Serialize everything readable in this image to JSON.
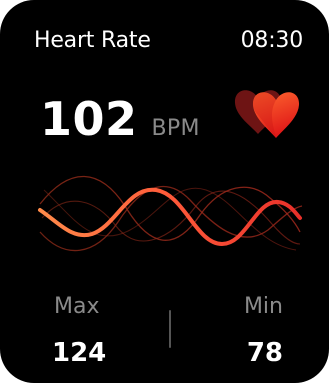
{
  "screen": {
    "title": "Heart Rate",
    "time": "08:30"
  },
  "reading": {
    "value": "102",
    "unit": "BPM"
  },
  "stats": {
    "max_label": "Max",
    "max_value": "124",
    "min_label": "Min",
    "min_value": "78"
  },
  "icons": {
    "heart": "heart-icon",
    "waveform": "heart-rate-waveform"
  },
  "colors": {
    "background": "#000000",
    "accent_orange": "#ff7a3c",
    "accent_red": "#e8201f",
    "muted_text": "#8a8a8a"
  }
}
